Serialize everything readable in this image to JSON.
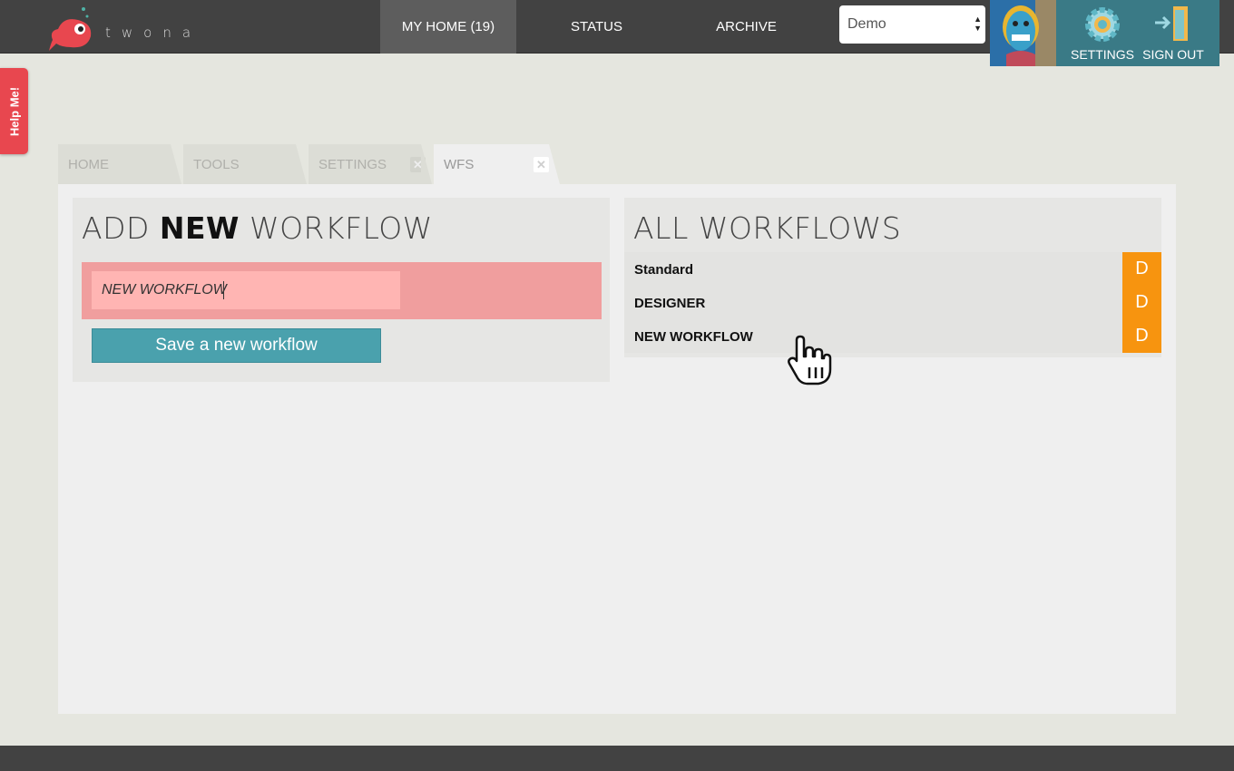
{
  "app": {
    "logo_text": "twona"
  },
  "nav": {
    "my_home": "MY HOME (19)",
    "status": "STATUS",
    "archive": "ARCHIVE"
  },
  "org_select": {
    "value": "Demo"
  },
  "user_panel": {
    "settings_label": "SETTINGS",
    "signout_label": "SIGN OUT"
  },
  "help": {
    "label": "Help Me!"
  },
  "tabs": [
    {
      "label": "HOME"
    },
    {
      "label": "TOOLS"
    },
    {
      "label": "SETTINGS"
    },
    {
      "label": "WFS"
    }
  ],
  "add_panel": {
    "heading_pre": "ADD ",
    "heading_bold": "NEW",
    "heading_post": " WORKFLOW",
    "input_value": "NEW WORKFLOW",
    "save_label": "Save a new workflow"
  },
  "all_panel": {
    "heading": "ALL WORKFLOWS",
    "workflows": [
      {
        "name": "Standard",
        "delete_label": "D"
      },
      {
        "name": "DESIGNER",
        "delete_label": "D"
      },
      {
        "name": "NEW WORKFLOW",
        "delete_label": "D"
      }
    ]
  },
  "colors": {
    "topbar": "#424242",
    "accent_teal": "#4aa1ad",
    "delete_orange": "#f7940f",
    "error_pink": "#f09e9e",
    "help_red": "#e8474f"
  }
}
